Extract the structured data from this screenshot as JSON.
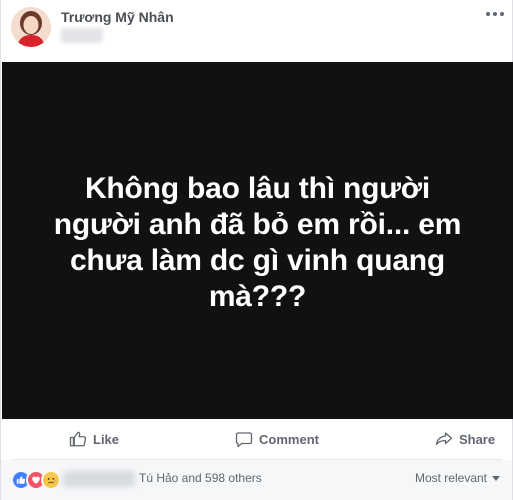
{
  "post": {
    "author": "Trương Mỹ Nhân",
    "image_text": "Không bao lâu thì người người anh đã bỏ em rồi... em chưa làm dc gì vinh quang mà???"
  },
  "actions": {
    "like": "Like",
    "comment": "Comment",
    "share": "Share"
  },
  "reactions": {
    "summary": "Tú Hảo and 598 others",
    "icons": [
      "like-icon",
      "love-icon",
      "sad-icon"
    ],
    "sort": "Most relevant"
  },
  "colors": {
    "author": "#4b4f56",
    "image_bg": "#111112",
    "like": "#4080ff",
    "love": "#f25268",
    "sad": "#f7c84a",
    "footer_bg": "#f6f7f9"
  }
}
